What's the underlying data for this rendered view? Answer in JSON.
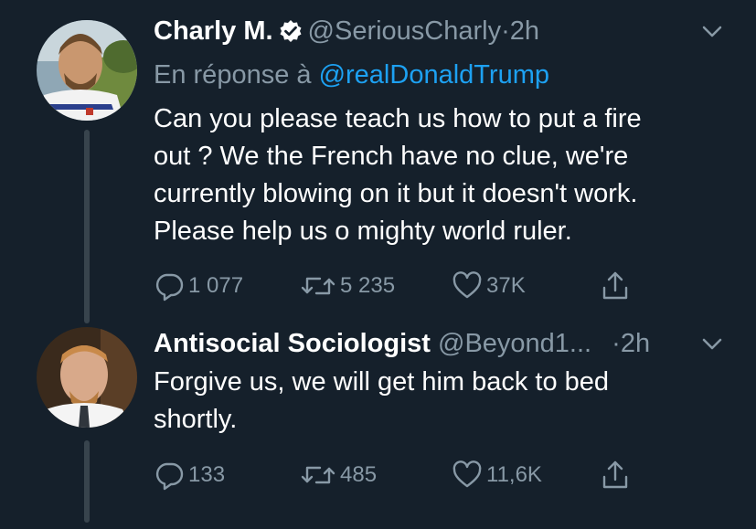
{
  "tweets": [
    {
      "display_name": "Charly M.",
      "handle": "@SeriousCharly",
      "separator": "·",
      "time": "2h",
      "reply_prefix": "En réponse à",
      "reply_mention": "@realDonaldTrump",
      "text_lines": [
        "Can you please teach us how to put a fire",
        "out ? We the French have no clue, we're",
        "currently blowing on it but it doesn't work.",
        "Please help us o mighty world ruler."
      ],
      "replies": "1 077",
      "retweets": "5 235",
      "likes": "37K",
      "verified": true
    },
    {
      "display_name": "Antisocial Sociologist",
      "handle": "@Beyond1...",
      "separator": "·",
      "time": "2h",
      "text_lines": [
        "Forgive us, we will get him back to bed",
        "shortly."
      ],
      "replies": "133",
      "retweets": "485",
      "likes": "11,6K",
      "verified": false
    }
  ],
  "icons": {
    "reply": "reply-icon",
    "retweet": "retweet-icon",
    "like": "heart-icon",
    "share": "share-icon",
    "caret": "chevron-down-icon",
    "verified": "verified-badge-icon"
  },
  "colors": {
    "background": "#15202b",
    "text": "#ffffff",
    "secondary": "#8899a6",
    "link": "#1da1f2",
    "thread_line": "#38444d"
  }
}
